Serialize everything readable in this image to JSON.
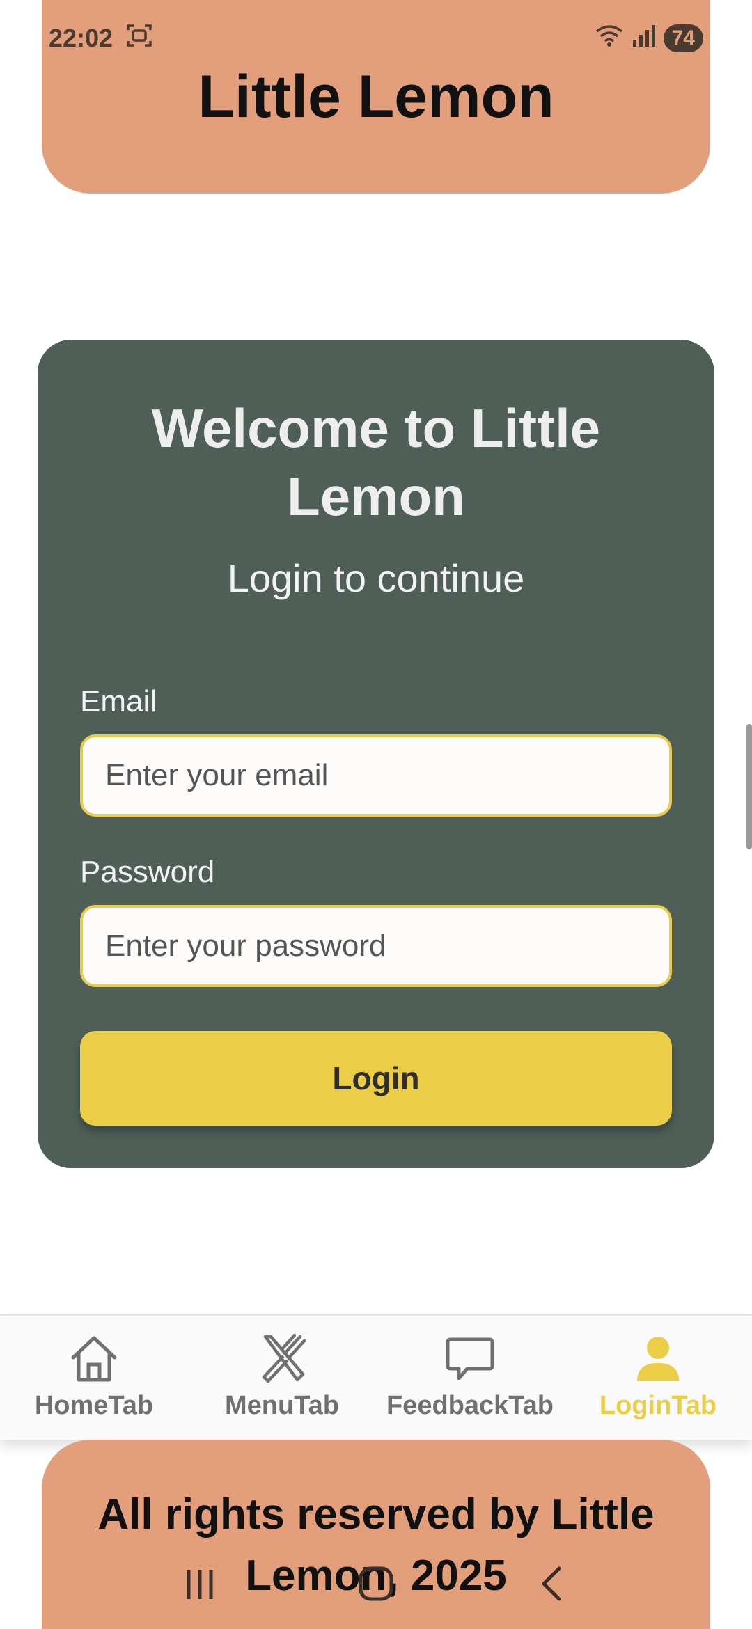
{
  "status_bar": {
    "time": "22:02",
    "battery": "74"
  },
  "header": {
    "title": "Little Lemon"
  },
  "login_card": {
    "welcome": "Welcome to Little Lemon",
    "subtitle": "Login to continue",
    "email_label": "Email",
    "email_placeholder": "Enter your email",
    "password_label": "Password",
    "password_placeholder": "Enter your password",
    "login_button": "Login"
  },
  "tabs": [
    {
      "label": "HomeTab",
      "icon": "home-icon",
      "active": false
    },
    {
      "label": "MenuTab",
      "icon": "utensils-icon",
      "active": false
    },
    {
      "label": "FeedbackTab",
      "icon": "chat-bubble-icon",
      "active": false
    },
    {
      "label": "LoginTab",
      "icon": "person-icon",
      "active": true
    }
  ],
  "footer": {
    "text": "All rights reserved by Little Lemon, 2025"
  },
  "colors": {
    "header_bg": "#e39e7b",
    "card_bg": "#4f5f58",
    "accent_yellow": "#ebcd47",
    "tab_inactive": "#707070"
  }
}
